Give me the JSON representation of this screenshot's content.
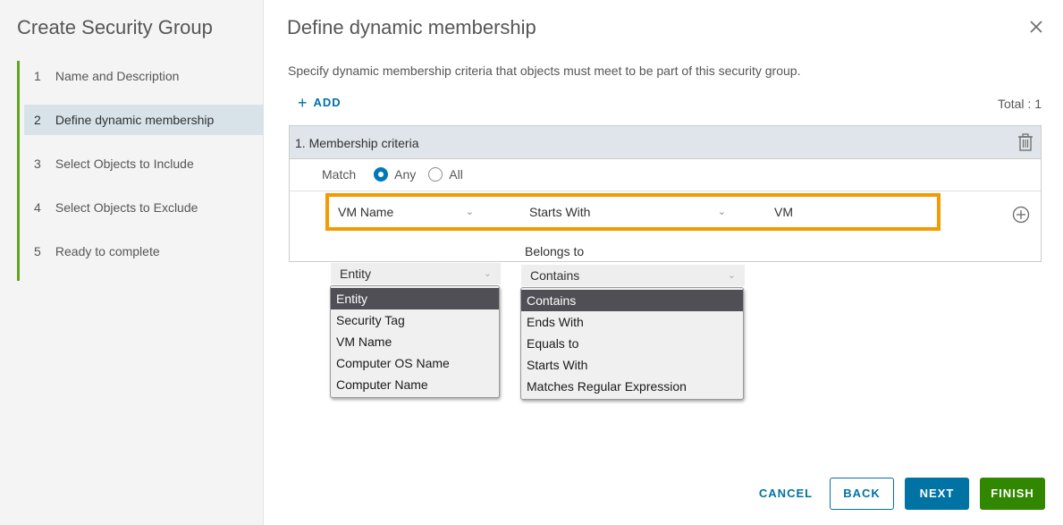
{
  "sidebar": {
    "title": "Create Security Group",
    "steps": [
      {
        "num": "1",
        "label": "Name and Description"
      },
      {
        "num": "2",
        "label": "Define dynamic membership"
      },
      {
        "num": "3",
        "label": "Select Objects to Include"
      },
      {
        "num": "4",
        "label": "Select Objects to Exclude"
      },
      {
        "num": "5",
        "label": "Ready to complete"
      }
    ],
    "active_step": 2,
    "accent_color": "#62a420"
  },
  "main": {
    "title": "Define dynamic membership",
    "description": "Specify dynamic membership criteria that objects must meet to be part of this security group.",
    "add_label": "ADD",
    "total": "Total : 1",
    "criteria": {
      "title": "1. Membership criteria",
      "match_label": "Match",
      "match_options": [
        "Any",
        "All"
      ],
      "match_selected": "Any",
      "rule": {
        "field": "VM Name",
        "operator": "Starts With",
        "value": "VM"
      },
      "highlight_color": "#f59a00"
    },
    "belongs_to_label": "Belongs to",
    "entity_dropdown": {
      "selected": "Entity",
      "options": [
        "Entity",
        "Security Tag",
        "VM Name",
        "Computer OS Name",
        "Computer Name"
      ]
    },
    "operator_dropdown": {
      "selected": "Contains",
      "options": [
        "Contains",
        "Ends With",
        "Equals to",
        "Starts With",
        "Matches Regular Expression"
      ]
    }
  },
  "footer": {
    "cancel": "CANCEL",
    "back": "BACK",
    "next": "NEXT",
    "finish": "FINISH"
  }
}
